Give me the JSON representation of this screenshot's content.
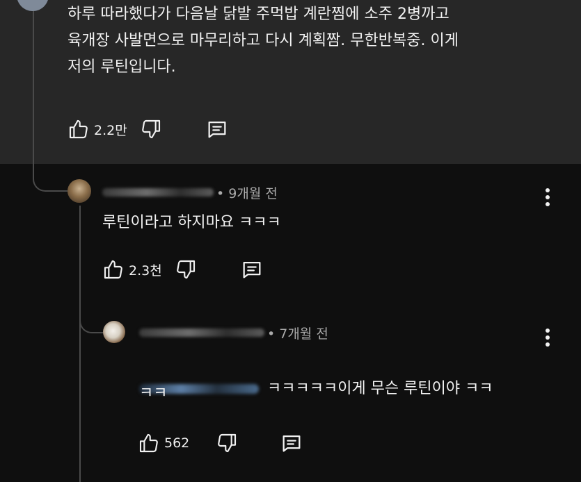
{
  "comment1": {
    "text": "하루 따라했다가 다음날 닭발 주먹밥 계란찜에 소주 2병까고\n육개장 사발면으로 마무리하고 다시 계획짬. 무한반복중. 이게\n저의 루틴입니다.",
    "likes": "2.2만"
  },
  "reply1": {
    "time": "• 9개월 전",
    "text": "루틴이라고 하지마요 ㅋㅋㅋ",
    "likes": "2.3천"
  },
  "reply2": {
    "time": "• 7개월 전",
    "text_line1": "ㅋㅋㅋㅋㅋ이게 무슨 루틴이야 ㅋㅋ",
    "text_line2": "ㅋㅋ",
    "likes": "562"
  },
  "icons": {
    "like": "thumbs-up-icon",
    "dislike": "thumbs-down-icon",
    "reply": "reply-icon",
    "more": "more-vertical-icon"
  }
}
